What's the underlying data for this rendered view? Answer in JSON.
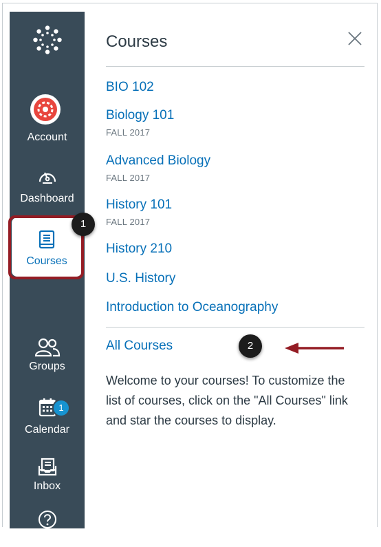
{
  "nav": {
    "account": "Account",
    "dashboard": "Dashboard",
    "courses": "Courses",
    "groups": "Groups",
    "calendar": "Calendar",
    "inbox": "Inbox",
    "inbox_count": "1",
    "help": "Help"
  },
  "tray": {
    "title": "Courses",
    "courses": [
      {
        "name": "BIO 102",
        "term": ""
      },
      {
        "name": "Biology 101",
        "term": "FALL 2017"
      },
      {
        "name": "Advanced Biology",
        "term": "FALL 2017"
      },
      {
        "name": "History 101",
        "term": "FALL 2017"
      },
      {
        "name": "History 210",
        "term": ""
      },
      {
        "name": "U.S. History",
        "term": ""
      },
      {
        "name": "Introduction to Oceanography",
        "term": ""
      }
    ],
    "all_courses": "All Courses",
    "welcome": "Welcome to your courses! To customize the list of courses, click on the \"All Courses\" link and star the courses to display."
  },
  "callouts": {
    "one": "1",
    "two": "2"
  },
  "colors": {
    "sidebar": "#394b58",
    "link": "#0770b8",
    "callout_outline": "#941c24",
    "inbox_badge": "#1793d1"
  },
  "icons": [
    "canvas-logo-icon",
    "account-avatar-icon",
    "dashboard-icon",
    "courses-icon",
    "groups-icon",
    "calendar-icon",
    "inbox-icon",
    "help-icon",
    "close-icon",
    "arrow-left-icon"
  ]
}
